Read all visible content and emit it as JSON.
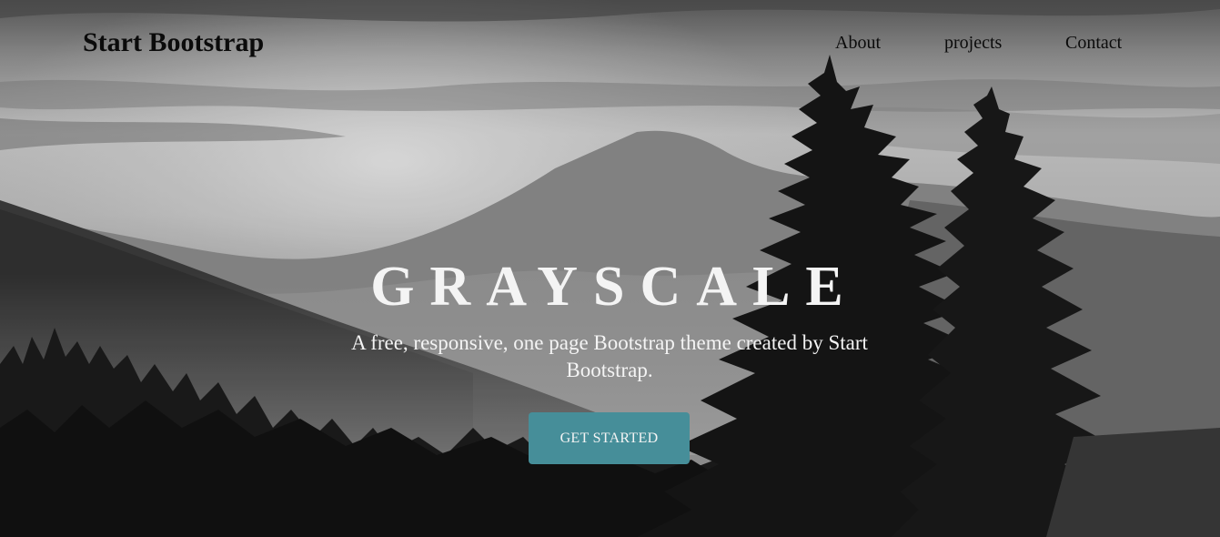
{
  "navbar": {
    "brand": "Start Bootstrap",
    "links": [
      {
        "label": "About"
      },
      {
        "label": "projects"
      },
      {
        "label": "Contact"
      }
    ]
  },
  "hero": {
    "headline": "GRAYSCALE",
    "tagline": "A free, responsive, one page Bootstrap theme created by Start Bootstrap.",
    "cta_label": "GET STARTED",
    "background_image": "grayscale mountain and pine forest photograph"
  },
  "colors": {
    "cta_background": "#468e99",
    "hero_text": "#f4f4f4",
    "nav_text": "#0b0b0b"
  }
}
